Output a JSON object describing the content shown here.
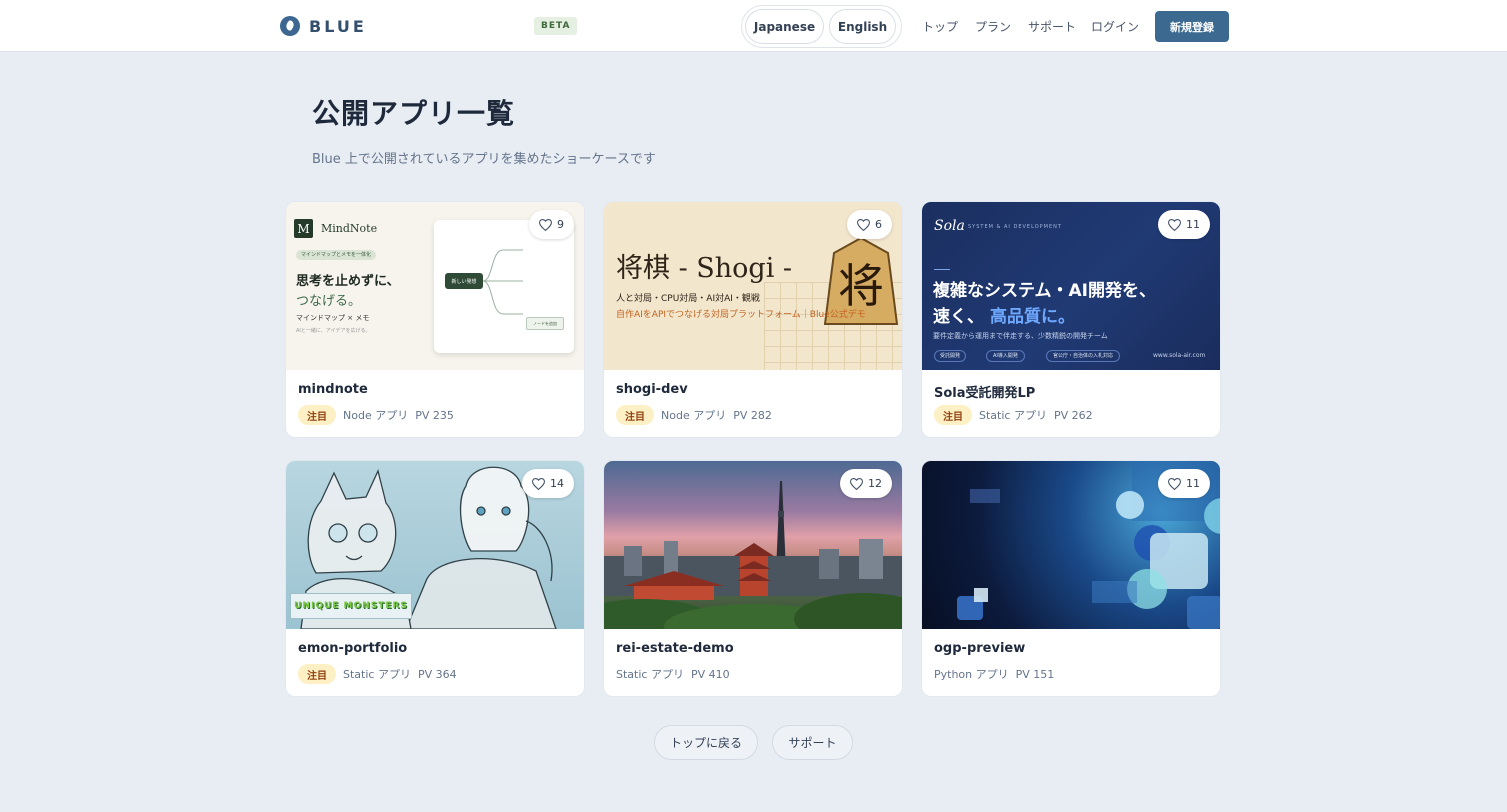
{
  "header": {
    "brand": "BLUE",
    "beta": "BETA",
    "lang_ja": "Japanese",
    "lang_en": "English",
    "nav": [
      "トップ",
      "プラン",
      "サポート",
      "ログイン"
    ],
    "signup": "新規登録"
  },
  "page": {
    "title": "公開アプリ一覧",
    "subtitle": "Blue 上で公開されているアプリを集めたショーケースです"
  },
  "cards": [
    {
      "title": "mindnote",
      "badge": "注目",
      "type": "Node アプリ",
      "pv": "PV 235",
      "likes": "9",
      "thumb": {
        "brand": "MindNote",
        "logo_letter": "M",
        "tag": "マインドマップとメモを一体化",
        "line1": "思考を止めずに、",
        "line2": "つなげる。",
        "line3": "マインドマップ × メモ",
        "line4": "AIと一緒に、アイデアを広げる。",
        "node": "新しい発想",
        "cta": "ノードを追加"
      }
    },
    {
      "title": "shogi-dev",
      "badge": "注目",
      "type": "Node アプリ",
      "pv": "PV 282",
      "likes": "6",
      "thumb": {
        "title": "将棋 - Shogi -",
        "piece": "将",
        "line1": "人と対局・CPU対局・AI対AI・観戦",
        "line2": "自作AIをAPIでつなげる対局プラットフォーム｜Blue公式デモ"
      }
    },
    {
      "title": "Sola受託開発LP",
      "badge": "注目",
      "type": "Static アプリ",
      "pv": "PV 262",
      "likes": "11",
      "thumb": {
        "brand": "Sola",
        "brand_sub": "SYSTEM & AI DEVELOPMENT",
        "line1": "複雑なシステム・AI開発を、",
        "line2a": "速く、",
        "line2b": "高品質に。",
        "line3": "要件定義から運用まで伴走する、少数精鋭の開発チーム",
        "chips": [
          "受託開発",
          "AI導入開発",
          "官公庁・自治体の入札対応"
        ],
        "url": "www.sola-air.com"
      }
    },
    {
      "title": "emon-portfolio",
      "badge": "注目",
      "type": "Static アプリ",
      "pv": "PV 364",
      "likes": "14",
      "thumb": {
        "logo": "UNIQUE MONSTERS"
      }
    },
    {
      "title": "rei-estate-demo",
      "badge": "",
      "type": "Static アプリ",
      "pv": "PV 410",
      "likes": "12",
      "thumb": {}
    },
    {
      "title": "ogp-preview",
      "badge": "",
      "type": "Python アプリ",
      "pv": "PV 151",
      "likes": "11",
      "thumb": {}
    }
  ],
  "footer": {
    "back_top": "トップに戻る",
    "support": "サポート"
  },
  "colors": {
    "primary": "#3b6990",
    "background": "#e8edf3",
    "badge": "#fdf0c4"
  },
  "icons": [
    "logo-icon",
    "heart-icon"
  ]
}
